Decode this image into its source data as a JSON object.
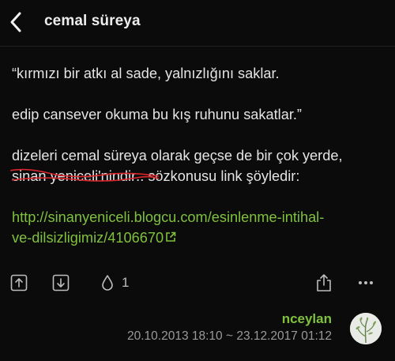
{
  "header": {
    "back_icon": "chevron-left-icon",
    "title": "cemal süreya"
  },
  "entry": {
    "line1": "“kırmızı bir atkı al sade, yalnızlığını saklar.",
    "line2": "edip cansever okuma bu kış ruhunu sakatlar.”",
    "line3": "dizeleri cemal süreya olarak geçse de bir çok yerde,",
    "line4_struck": "sinan yeniceli'nindir",
    "line4_rest": ".. sözkonusu link şöyledir:",
    "link_line1": "http://sinanyeniceli.blogcu.com/esinlenme-intihal-",
    "link_line2": "ve-dilsizligimiz/4106670",
    "link_icon": "external-link-icon",
    "strike_color": "#d9262b",
    "link_color": "#7fc13c"
  },
  "actions": {
    "upvote_icon": "upvote-icon",
    "downvote_icon": "downvote-icon",
    "favorite_icon": "drop-icon",
    "favorite_count": "1",
    "share_icon": "share-icon",
    "more_icon": "more-icon"
  },
  "meta": {
    "author": "nceylan",
    "dates": "20.10.2013 18:10 ~ 23.12.2017 01:12",
    "avatar_icon": "avatar-plant-icon"
  }
}
